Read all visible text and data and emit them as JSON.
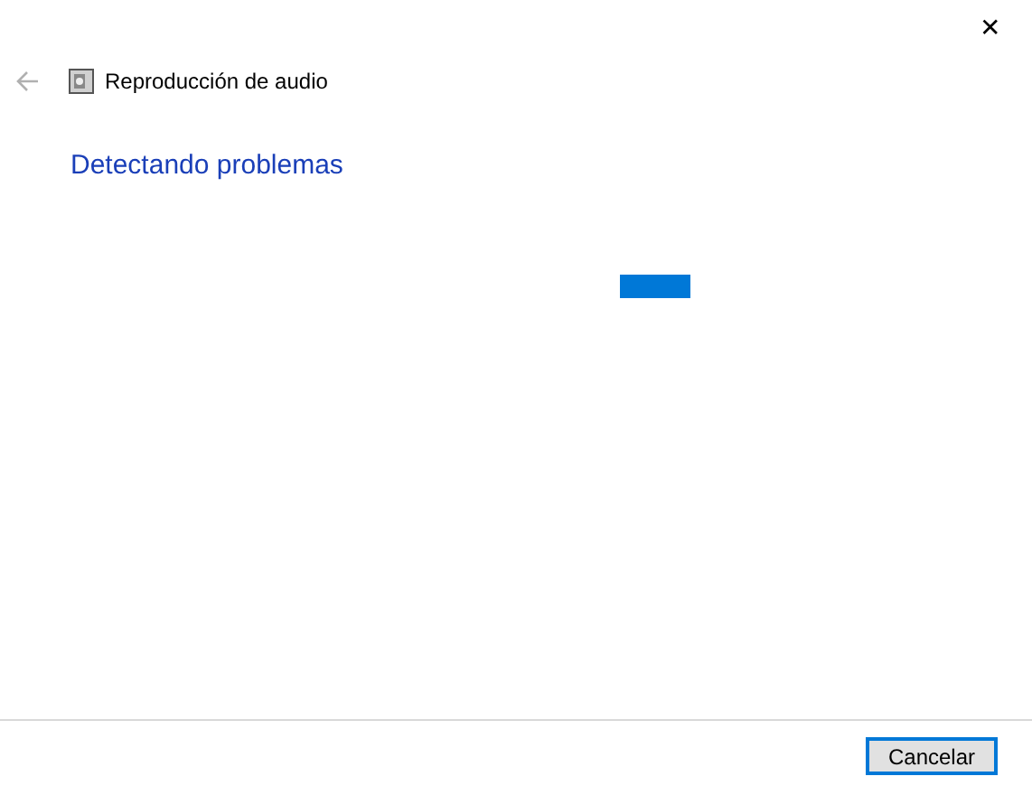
{
  "window": {
    "title": "Reproducción de audio",
    "close": "✕"
  },
  "heading": "Detectando problemas",
  "buttons": [
    {
      "label": "Cancelar",
      "focused": true
    }
  ]
}
